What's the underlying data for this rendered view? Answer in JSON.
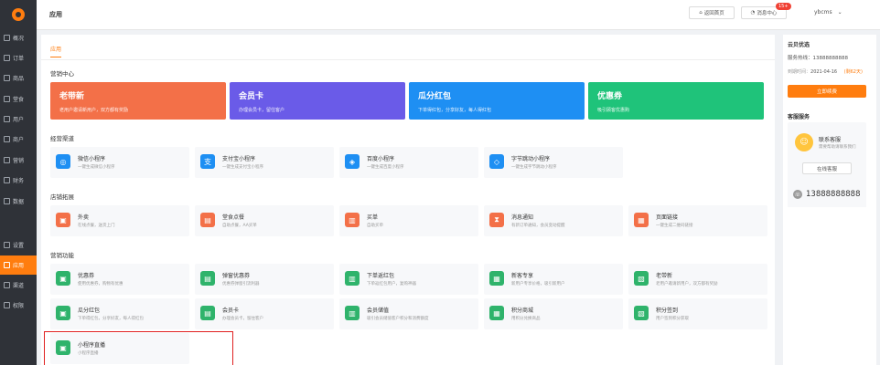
{
  "sidebar": {
    "items": [
      {
        "label": "概况"
      },
      {
        "label": "订单"
      },
      {
        "label": "商品"
      },
      {
        "label": "堂食"
      },
      {
        "label": "用户"
      },
      {
        "label": "商户"
      },
      {
        "label": "营销"
      },
      {
        "label": "财务"
      },
      {
        "label": "数据"
      },
      {
        "label": "设置"
      },
      {
        "label": "应用"
      },
      {
        "label": "渠道"
      },
      {
        "label": "权限"
      }
    ]
  },
  "header": {
    "title": "应用",
    "home_button": "返回首页",
    "message_button": "消息中心",
    "message_badge": "15+",
    "username": "ybcms"
  },
  "main": {
    "tab": "应用",
    "marketing_center": {
      "title": "营销中心",
      "cards": [
        {
          "title": "老带新",
          "desc": "老用户邀请新用户，双方都有奖励",
          "color": "#f37048"
        },
        {
          "title": "会员卡",
          "desc": "办理会员卡，留住客户",
          "color": "#6a5be8"
        },
        {
          "title": "瓜分红包",
          "desc": "下单得红包，分享好友，每人得红包",
          "color": "#1e8ff3"
        },
        {
          "title": "优惠券",
          "desc": "吸引顾客优惠购",
          "color": "#1fc37a"
        }
      ]
    },
    "channels": {
      "title": "经营渠道",
      "items": [
        {
          "name": "微信小程序",
          "desc": "一键生成微信小程序"
        },
        {
          "name": "支付宝小程序",
          "desc": "一键生成支付宝小程序"
        },
        {
          "name": "百度小程序",
          "desc": "一键生成百度小程序"
        },
        {
          "name": "字节跳动小程序",
          "desc": "一键生成字节跳动小程序"
        }
      ]
    },
    "store_expansion": {
      "title": "店铺拓展",
      "items": [
        {
          "name": "外卖",
          "desc": "在线点餐，送货上门"
        },
        {
          "name": "堂食点餐",
          "desc": "自助点餐，AA买单"
        },
        {
          "name": "买单",
          "desc": "自助买单"
        },
        {
          "name": "消息通知",
          "desc": "有新订单通知，会员变动提醒"
        },
        {
          "name": "页面链接",
          "desc": "一键生成二维码链接"
        }
      ]
    },
    "marketing_features": {
      "title": "营销功能",
      "items": [
        {
          "name": "优惠券",
          "desc": "使用优惠券，购物有优惠"
        },
        {
          "name": "弹窗优惠券",
          "desc": "优惠券弹窗引流利器"
        },
        {
          "name": "下单返红包",
          "desc": "下单返红包用户，复购神器"
        },
        {
          "name": "新客专享",
          "desc": "新用户专享价格，吸引新用户"
        },
        {
          "name": "老带新",
          "desc": "老用户邀请新用户，双方都有奖励"
        },
        {
          "name": "瓜分红包",
          "desc": "下单得红包，分享好友，每人得红包"
        },
        {
          "name": "会员卡",
          "desc": "办理会员卡，留住客户"
        },
        {
          "name": "会员储值",
          "desc": "吸引会员储值客户积分和消费额度"
        },
        {
          "name": "积分商城",
          "desc": "用积分兑换商品"
        },
        {
          "name": "积分签到",
          "desc": "用户签到积分获取"
        },
        {
          "name": "小程序直播",
          "desc": "小程序直播"
        }
      ]
    }
  },
  "right_panel": {
    "title": "云贝优选",
    "phone_line": "服务热线：13888888888",
    "expire_label": "到期时间：",
    "expire_date": "2021-04-16",
    "remaining": "(剩62天)",
    "renew_button": "立即续费",
    "service_title": "客服服务",
    "contact_title": "联系客服",
    "contact_desc": "需要帮助请联系我们",
    "online_button": "在线客服",
    "hotline": "13888888888"
  },
  "colors": {
    "accent": "#ff7d0f",
    "sidebar_bg": "#2f3238",
    "highlight_border": "#e02020"
  }
}
